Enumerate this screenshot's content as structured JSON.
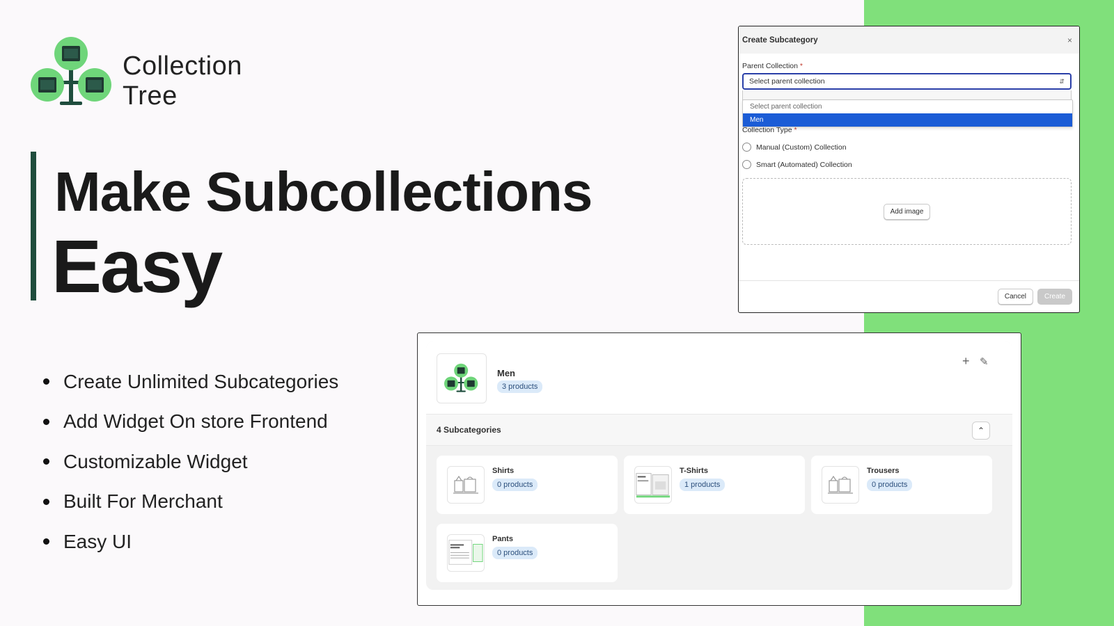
{
  "brand": {
    "name_line1": "Collection",
    "name_line2": "Tree",
    "accent_color": "#80e07b",
    "icon": "collection-tree-logo-icon"
  },
  "headline": {
    "line1": "Make Subcollections",
    "line2": "Easy"
  },
  "features": [
    "Create Unlimited Subcategories",
    "Add Widget On store Frontend",
    "Customizable Widget",
    "Built For Merchant",
    "Easy UI"
  ],
  "dialog": {
    "title": "Create Subcategory",
    "close_icon": "×",
    "parent_label": "Parent Collection",
    "required_mark": "*",
    "parent_value": "Select parent collection",
    "dropdown_options": [
      "Select parent collection",
      "Men"
    ],
    "selected_option": "Men",
    "type_label": "Collection Type",
    "type_options": [
      "Manual (Custom) Collection",
      "Smart (Automated) Collection"
    ],
    "add_image_label": "Add image",
    "cancel_label": "Cancel",
    "create_label": "Create"
  },
  "collection": {
    "name": "Men",
    "product_count": "3 products",
    "subcategories_title": "4 Subcategories",
    "subcategories": [
      {
        "name": "Shirts",
        "count": "0 products"
      },
      {
        "name": "T-Shirts",
        "count": "1 products"
      },
      {
        "name": "Trousers",
        "count": "0 products"
      },
      {
        "name": "Pants",
        "count": "0 products"
      }
    ]
  }
}
